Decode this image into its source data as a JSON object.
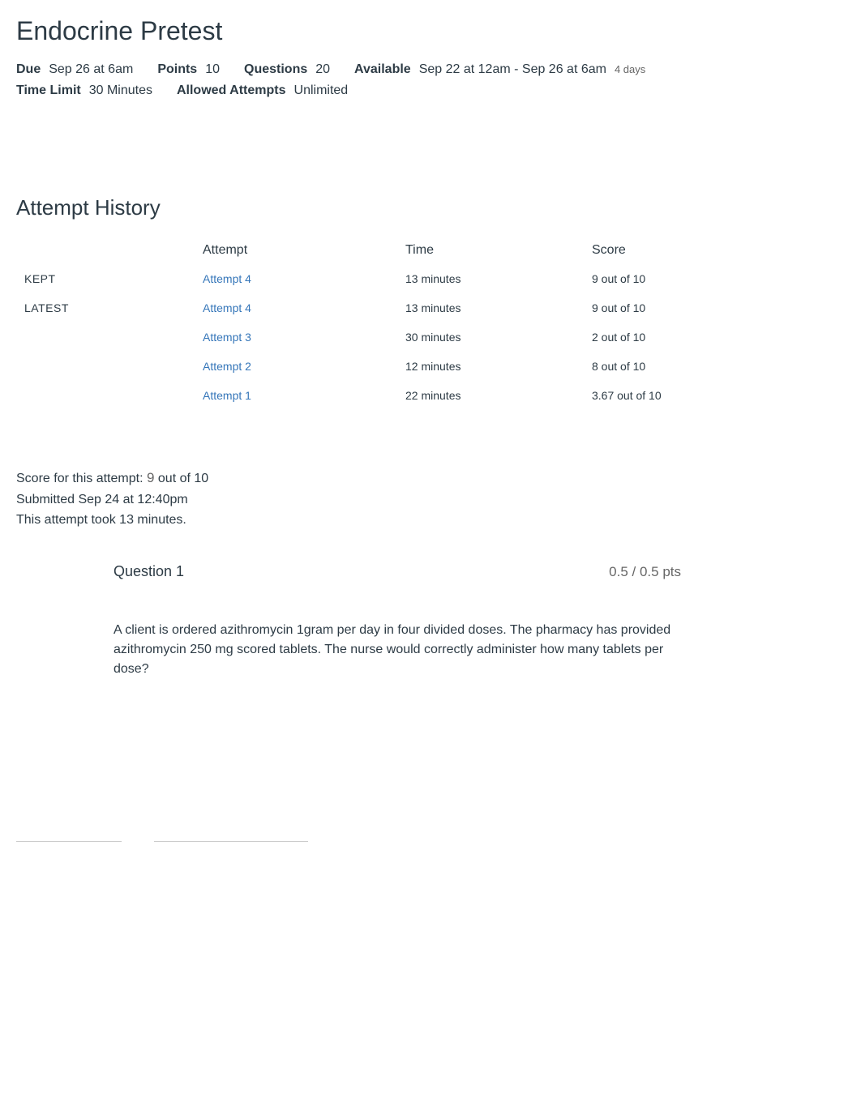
{
  "header": {
    "title": "Endocrine Pretest",
    "meta": {
      "due_label": "Due",
      "due_value": "Sep 26 at 6am",
      "points_label": "Points",
      "points_value": "10",
      "questions_label": "Questions",
      "questions_value": "20",
      "available_label": "Available",
      "available_value": "Sep 22 at 12am - Sep 26 at 6am",
      "available_duration": "4 days",
      "timelimit_label": "Time Limit",
      "timelimit_value": "30 Minutes",
      "allowed_label": "Allowed Attempts",
      "allowed_value": "Unlimited"
    }
  },
  "history": {
    "heading": "Attempt History",
    "columns": {
      "label": "",
      "attempt": "Attempt",
      "time": "Time",
      "score": "Score"
    },
    "rows": [
      {
        "tag": "KEPT",
        "attempt": "Attempt 4",
        "time": "13 minutes",
        "score": "9 out of 10"
      },
      {
        "tag": "LATEST",
        "attempt": "Attempt 4",
        "time": "13 minutes",
        "score": "9 out of 10"
      },
      {
        "tag": "",
        "attempt": "Attempt 3",
        "time": "30 minutes",
        "score": "2 out of 10"
      },
      {
        "tag": "",
        "attempt": "Attempt 2",
        "time": "12 minutes",
        "score": "8 out of 10"
      },
      {
        "tag": "",
        "attempt": "Attempt 1",
        "time": "22 minutes",
        "score": "3.67 out of 10"
      }
    ]
  },
  "summary": {
    "score_label": "Score for this attempt:",
    "score_value": "9",
    "score_suffix": "out of 10",
    "submitted": "Submitted Sep 24 at 12:40pm",
    "duration": "This attempt took 13 minutes."
  },
  "question": {
    "label": "Question 1",
    "points": "0.5 / 0.5 pts",
    "text": "A client is ordered azithromycin 1gram per day in four divided doses. The pharmacy has provided azithromycin 250 mg scored tablets. The nurse would correctly administer how many tablets per dose?"
  }
}
